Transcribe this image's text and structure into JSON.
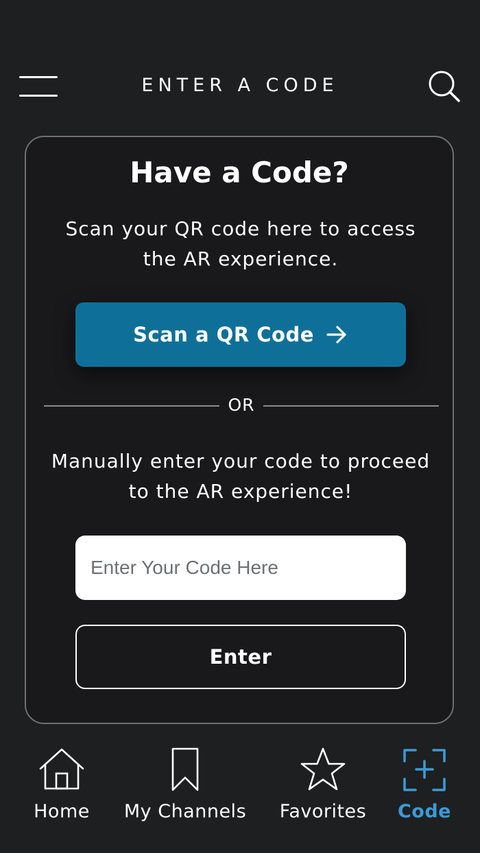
{
  "header": {
    "title": "ENTER A CODE",
    "menu_icon": "hamburger-menu-icon",
    "search_icon": "search-icon"
  },
  "card": {
    "title": "Have a Code?",
    "subtitle": "Scan your QR code here to access the AR experience.",
    "scan_button_label": "Scan a QR Code",
    "scan_button_icon": "arrow-right-icon",
    "divider_text": "OR",
    "manual_text": "Manually enter your code to proceed to the AR experience!",
    "code_input": {
      "value": "",
      "placeholder": "Enter Your Code Here"
    },
    "enter_button_label": "Enter"
  },
  "tabbar": {
    "items": [
      {
        "label": "Home",
        "icon": "home-icon",
        "active": false
      },
      {
        "label": "My Channels",
        "icon": "bookmark-icon",
        "active": false
      },
      {
        "label": "Favorites",
        "icon": "star-icon",
        "active": false
      },
      {
        "label": "Code",
        "icon": "scan-code-icon",
        "active": true
      }
    ]
  },
  "colors": {
    "background": "#1e1f21",
    "card_background": "#19191b",
    "primary_button": "#0e7099",
    "active_tab": "#3a9bd5",
    "card_border": "#6f7072"
  }
}
